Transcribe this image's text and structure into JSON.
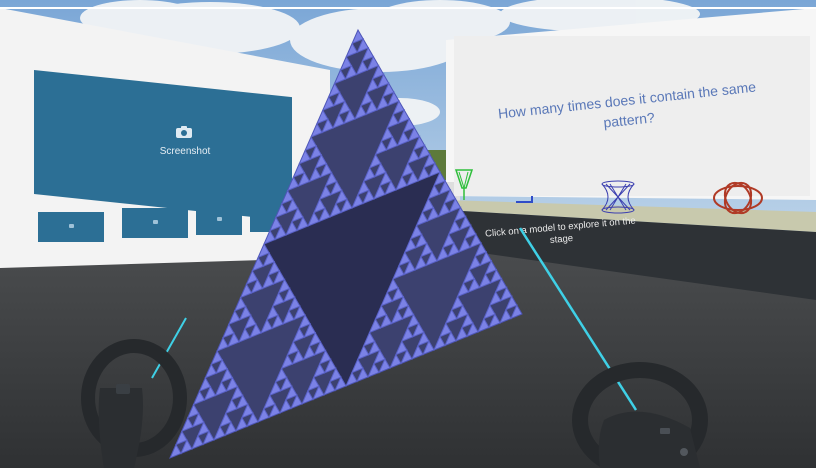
{
  "gallery": {
    "main_screen_label": "Screenshot",
    "main_screen_icon": "camera-icon",
    "thumbnail_count": 4
  },
  "question_board": {
    "text": "How many times does it contain the same pattern?"
  },
  "model_shelf": {
    "instruction": "Click on a model to explore it on the stage",
    "models": [
      "cone-model",
      "small-bracket-model",
      "hyperboloid-model",
      "torus-knot-model"
    ]
  },
  "stage_model": {
    "name": "sierpinski-pyramid",
    "color": "#7b82e6"
  },
  "controllers": {
    "left": "left-motion-controller",
    "right": "right-motion-controller",
    "ray_color": "#3fd0e6"
  },
  "colors": {
    "sky": "#8fb6dc",
    "floor": "#3d3f41",
    "screen_blue": "#2c6f95",
    "question_text": "#5a78b8",
    "counter": "#2e3236"
  }
}
